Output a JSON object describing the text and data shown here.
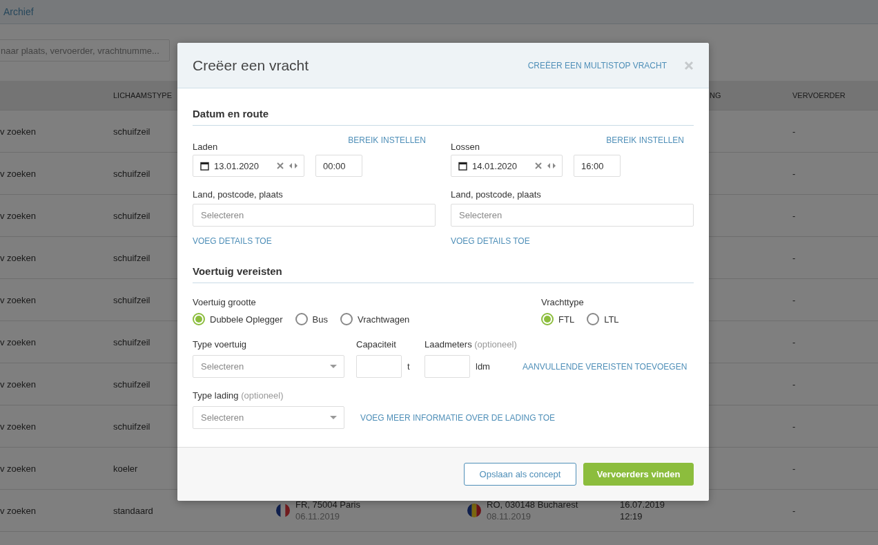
{
  "topbar": {
    "tab": "Archief"
  },
  "search": {
    "placeholder": "naar plaats, vervoerder, vrachtnumme..."
  },
  "table": {
    "columns": [
      {
        "label": "LICHAAMSTYPE"
      },
      {
        "label": "NG"
      },
      {
        "label": "VERVOERDER"
      }
    ],
    "rows": [
      {
        "col_1": "v zoeken",
        "body_type": "schuifzeil",
        "carrier": "-"
      },
      {
        "col_1": "v zoeken",
        "body_type": "schuifzeil",
        "carrier": "-"
      },
      {
        "col_1": "v zoeken",
        "body_type": "schuifzeil",
        "carrier": "-"
      },
      {
        "col_1": "v zoeken",
        "body_type": "schuifzeil",
        "carrier": "-"
      },
      {
        "col_1": "v zoeken",
        "body_type": "schuifzeil",
        "carrier": "-"
      },
      {
        "col_1": "v zoeken",
        "body_type": "schuifzeil",
        "carrier": "-"
      },
      {
        "col_1": "v zoeken",
        "body_type": "schuifzeil",
        "carrier": "-"
      },
      {
        "col_1": "v zoeken",
        "body_type": "schuifzeil",
        "carrier": "-"
      },
      {
        "col_1": "v zoeken",
        "body_type": "koeler",
        "carrier": "-"
      },
      {
        "col_1": "v zoeken",
        "body_type": "standaard",
        "origin": {
          "flag_stripes": [
            {
              "color": "#0f1f4d"
            },
            {
              "color": "#7f7f7f"
            },
            {
              "color": "#701b1e"
            }
          ],
          "place": "FR, 75004 Paris",
          "date": "06.11.2019"
        },
        "destination": {
          "flag_stripes": [
            {
              "color": "#0f1f4d"
            },
            {
              "color": "#7a6710"
            },
            {
              "color": "#6a1317"
            }
          ],
          "place": "RO, 030148 Bucharest",
          "date": "08.11.2019"
        },
        "date": "16.07.2019",
        "time": "12:19",
        "carrier": "-"
      }
    ]
  },
  "dialog": {
    "title": "Creëer een vracht",
    "multistop_link": "CREËER EEN MULTISTOP VRACHT",
    "route": {
      "heading": "Datum en route",
      "stops": [
        {
          "label": "Laden",
          "range_link": "BEREIK INSTELLEN",
          "date": "13.01.2020",
          "time": "00:00",
          "location_label": "Land, postcode, plaats",
          "location_placeholder": "Selecteren",
          "details_link": "VOEG DETAILS TOE"
        },
        {
          "label": "Lossen",
          "range_link": "BEREIK INSTELLEN",
          "date": "14.01.2020",
          "time": "16:00",
          "location_label": "Land, postcode, plaats",
          "location_placeholder": "Selecteren",
          "details_link": "VOEG DETAILS TOE"
        }
      ]
    },
    "vehicle": {
      "heading": "Voertuig vereisten",
      "size": {
        "label": "Voertuig grootte",
        "options": [
          {
            "label": "Dubbele Oplegger",
            "selected": true
          },
          {
            "label": "Bus",
            "selected": false
          },
          {
            "label": "Vrachtwagen",
            "selected": false
          }
        ]
      },
      "freight_type": {
        "label": "Vrachttype",
        "options": [
          {
            "label": "FTL",
            "selected": true
          },
          {
            "label": "LTL",
            "selected": false
          }
        ]
      },
      "vehicle_type": {
        "label": "Type voertuig",
        "placeholder": "Selecteren"
      },
      "capacity": {
        "label": "Capaciteit",
        "unit": "t"
      },
      "loading_meters": {
        "label": "Laadmeters",
        "hint": "(optioneel)",
        "unit": "ldm"
      },
      "requirements_link": "AANVULLENDE VEREISTEN TOEVOEGEN",
      "cargo_type": {
        "label": "Type lading",
        "hint": "(optioneel)",
        "placeholder": "Selecteren"
      },
      "cargo_link": "VOEG MEER INFORMATIE OVER DE LADING TOE"
    },
    "buttons": [
      {
        "label": "Opslaan als concept",
        "kind": "outline"
      },
      {
        "label": "Vervoerders vinden",
        "kind": "primary"
      }
    ]
  }
}
